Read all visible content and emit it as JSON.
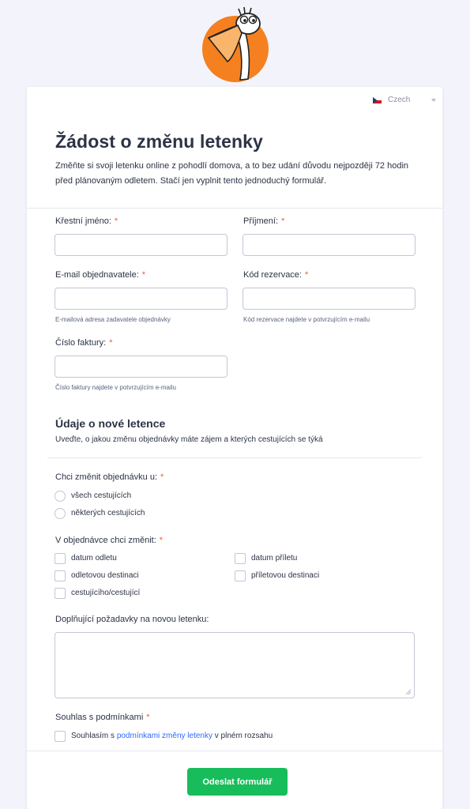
{
  "language": {
    "label": "Czech",
    "flag_icon": "czech-flag-icon"
  },
  "form": {
    "title": "Žádost o změnu letenky",
    "description": "Změňte si svoji letenku online z pohodlí domova, a to bez udání důvodu nejpozději 72 hodin před plánovaným odletem. Stačí jen vyplnit tento jednoduchý formulář."
  },
  "fields": {
    "first_name": {
      "label": "Křestní jméno:",
      "required": "*",
      "value": ""
    },
    "last_name": {
      "label": "Příjmení:",
      "required": "*",
      "value": ""
    },
    "email": {
      "label": "E-mail objednavatele:",
      "required": "*",
      "value": "",
      "sublabel": "E-mailová adresa zadavatele objednávky"
    },
    "booking_code": {
      "label": "Kód rezervace:",
      "required": "*",
      "value": "",
      "sublabel": "Kód rezervace najdete v potvrzujícím e-mailu"
    },
    "invoice_number": {
      "label": "Číslo faktury:",
      "required": "*",
      "value": "",
      "sublabel": "Číslo faktury najdete v potvrzujícím e-mailu"
    }
  },
  "section": {
    "title": "Údaje o nové letence",
    "description": "Uveďte, o jakou změnu objednávky máte zájem a kterých cestujících se týká"
  },
  "change_for": {
    "label": "Chci změnit objednávku u:",
    "required": "*",
    "options": [
      "všech cestujících",
      "některých cestujících"
    ],
    "selected": null
  },
  "change_what": {
    "label": "V objednávce chci změnit:",
    "required": "*",
    "options": [
      "datum odletu",
      "datum příletu",
      "odletovou destinaci",
      "příletovou destinaci",
      "cestujícího/cestující"
    ],
    "checked": []
  },
  "additional": {
    "label": "Doplňující požadavky na novou letenku:",
    "value": ""
  },
  "terms": {
    "label": "Souhlas s podmínkami",
    "required": "*",
    "text_before": "Souhlasím s ",
    "link_text": "podmínkami změny letenky",
    "text_after": " v plném rozsahu",
    "checked": false
  },
  "submit": {
    "label": "Odeslat formulář"
  },
  "colors": {
    "accent_orange": "#f4801f",
    "required_star": "#f05a3c",
    "link_blue": "#2e69ff",
    "submit_green": "#18bd5b",
    "page_background": "#f3f3fb"
  }
}
